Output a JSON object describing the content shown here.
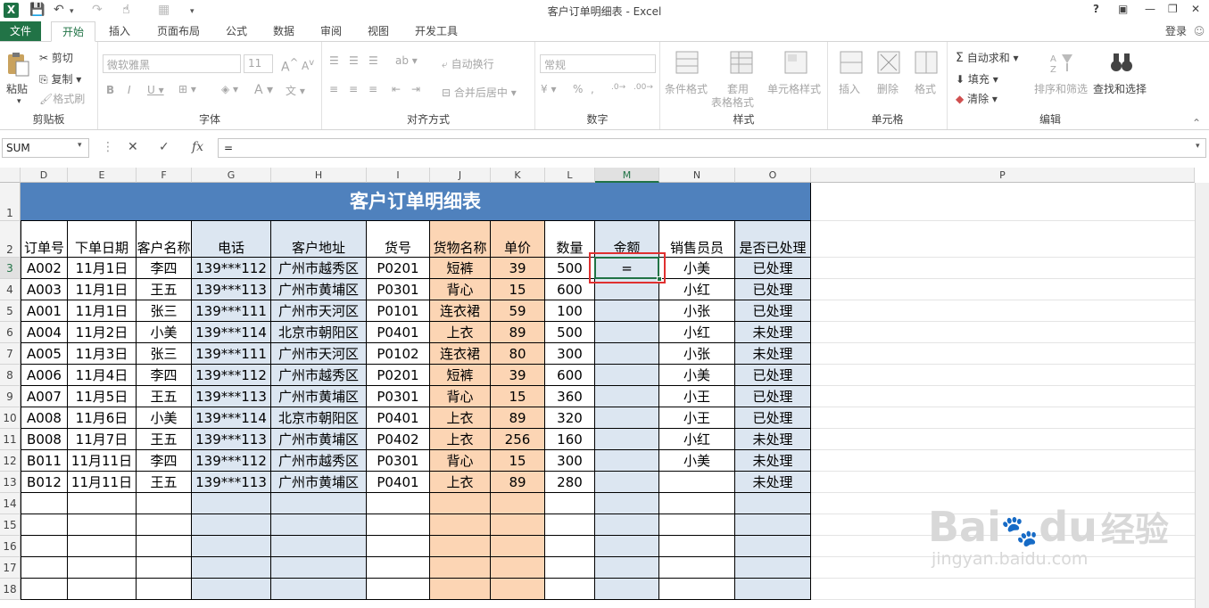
{
  "window": {
    "title": "客户订单明细表 - Excel",
    "help": "?",
    "login": "登录"
  },
  "tabs": [
    {
      "label": "文件"
    },
    {
      "label": "开始"
    },
    {
      "label": "插入"
    },
    {
      "label": "页面布局"
    },
    {
      "label": "公式"
    },
    {
      "label": "数据"
    },
    {
      "label": "审阅"
    },
    {
      "label": "视图"
    },
    {
      "label": "开发工具"
    }
  ],
  "ribbon": {
    "clipboard": {
      "label": "剪贴板",
      "paste": "粘贴",
      "cut": "剪切",
      "copy": "复制",
      "format_painter": "格式刷"
    },
    "font": {
      "label": "字体",
      "family": "微软雅黑",
      "size": "11"
    },
    "alignment": {
      "label": "对齐方式",
      "wrap": "自动换行",
      "merge": "合并后居中"
    },
    "number": {
      "label": "数字",
      "format": "常规"
    },
    "styles": {
      "label": "样式",
      "conditional": "条件格式",
      "table1": "套用",
      "table2": "表格格式",
      "cell_styles": "单元格样式"
    },
    "cells": {
      "label": "单元格",
      "insert": "插入",
      "delete": "删除",
      "format": "格式"
    },
    "editing": {
      "label": "编辑",
      "autosum": "自动求和",
      "fill": "填充",
      "clear": "清除",
      "sort": "排序和筛选",
      "find": "查找和选择"
    }
  },
  "formula_bar": {
    "name_box": "SUM",
    "formula": "="
  },
  "columns": [
    "D",
    "E",
    "F",
    "G",
    "H",
    "I",
    "J",
    "K",
    "L",
    "M",
    "N",
    "O",
    "P"
  ],
  "rows": [
    "1",
    "2",
    "3",
    "4",
    "5",
    "6",
    "7",
    "8",
    "9",
    "10",
    "11",
    "12",
    "13",
    "14",
    "15",
    "16",
    "17",
    "18"
  ],
  "sheet": {
    "title": "客户订单明细表",
    "headers": [
      "订单号",
      "下单日期",
      "客户名称",
      "电话",
      "客户地址",
      "货号",
      "货物名称",
      "单价",
      "数量",
      "金额",
      "销售员员",
      "是否已处理"
    ],
    "data": [
      [
        "A002",
        "11月1日",
        "李四",
        "139***112",
        "广州市越秀区",
        "P0201",
        "短裤",
        "39",
        "500",
        "=",
        "小美",
        "已处理"
      ],
      [
        "A003",
        "11月1日",
        "王五",
        "139***113",
        "广州市黄埔区",
        "P0301",
        "背心",
        "15",
        "600",
        "",
        "小红",
        "已处理"
      ],
      [
        "A001",
        "11月1日",
        "张三",
        "139***111",
        "广州市天河区",
        "P0101",
        "连衣裙",
        "59",
        "100",
        "",
        "小张",
        "已处理"
      ],
      [
        "A004",
        "11月2日",
        "小美",
        "139***114",
        "北京市朝阳区",
        "P0401",
        "上衣",
        "89",
        "500",
        "",
        "小红",
        "未处理"
      ],
      [
        "A005",
        "11月3日",
        "张三",
        "139***111",
        "广州市天河区",
        "P0102",
        "连衣裙",
        "80",
        "300",
        "",
        "小张",
        "未处理"
      ],
      [
        "A006",
        "11月4日",
        "李四",
        "139***112",
        "广州市越秀区",
        "P0201",
        "短裤",
        "39",
        "600",
        "",
        "小美",
        "已处理"
      ],
      [
        "A007",
        "11月5日",
        "王五",
        "139***113",
        "广州市黄埔区",
        "P0301",
        "背心",
        "15",
        "360",
        "",
        "小王",
        "已处理"
      ],
      [
        "A008",
        "11月6日",
        "小美",
        "139***114",
        "北京市朝阳区",
        "P0401",
        "上衣",
        "89",
        "320",
        "",
        "小王",
        "已处理"
      ],
      [
        "B008",
        "11月7日",
        "王五",
        "139***113",
        "广州市黄埔区",
        "P0402",
        "上衣",
        "256",
        "160",
        "",
        "小红",
        "未处理"
      ],
      [
        "B011",
        "11月11日",
        "李四",
        "139***112",
        "广州市越秀区",
        "P0301",
        "背心",
        "15",
        "300",
        "",
        "小美",
        "未处理"
      ],
      [
        "B012",
        "11月11日",
        "王五",
        "139***113",
        "广州市黄埔区",
        "P0401",
        "上衣",
        "89",
        "280",
        "",
        "",
        "未处理"
      ]
    ]
  },
  "watermark": {
    "line1": "Bai",
    "line1b": "du",
    "line1c": "经验",
    "line2": "jingyan.baidu.com"
  },
  "colors": {
    "excel_green": "#217346",
    "banner": "#4f81bd",
    "light_blue": "#dce6f1",
    "peach": "#fcd5b4",
    "selection_red": "#e03030"
  }
}
